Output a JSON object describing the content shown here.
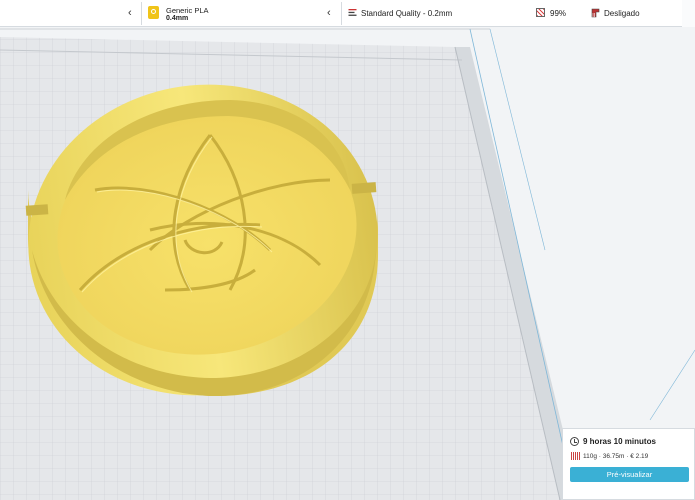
{
  "toolbar": {
    "material": {
      "name": "Generic PLA",
      "nozzle": "0.4mm",
      "badge_color": "#f0c419"
    },
    "quality": {
      "label": "Standard Quality - 0.2mm",
      "icon": "quality-profile-icon"
    },
    "infill": {
      "label": "99%",
      "icon": "infill-icon"
    },
    "support": {
      "label": "Desligado",
      "icon": "support-icon"
    },
    "chevrons": [
      "chevron-left-icon",
      "chevron-left-icon"
    ]
  },
  "viewport": {
    "build_plate_color": "#e4e6e8",
    "model_color": "#f3e16a",
    "model": "circular tray with star-of-life engraving"
  },
  "print_summary": {
    "time": "9 horas 10 minutos",
    "usage": "110g · 36.75m · € 2.19",
    "preview_button": "Pré-visualizar",
    "accent": "#3ab0d5"
  }
}
